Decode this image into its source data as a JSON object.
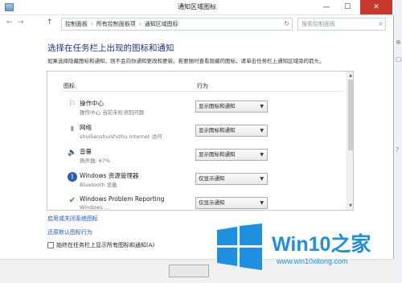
{
  "window": {
    "title": "通知区域图标"
  },
  "titlebar_buttons": {
    "min": "—",
    "max": "☐",
    "close": "✕"
  },
  "nav": {
    "back": "←",
    "forward": "→",
    "up": "↑",
    "breadcrumb": [
      "控制面板",
      "所有控制面板项",
      "通知区域图标"
    ],
    "refresh": "↻",
    "search_placeholder": "搜索控制面板"
  },
  "heading": "选择在任务栏上出现的图标和通知",
  "description": "如果选择隐藏图标和通知，则不会向你通知更改和更新。若要随时查看隐藏的图标，请单击任务栏上通知区域旁的箭头。",
  "table": {
    "col_icon": "图标",
    "col_behavior": "行为",
    "rows": [
      {
        "icon": "flag-icon",
        "glyph": "⚐",
        "name": "操作中心",
        "sub": "操作中心  当前未检测到问题",
        "behavior": "显示图标和通知"
      },
      {
        "icon": "network-icon",
        "glyph": "▮",
        "name": "网络",
        "sub": "shuilianshuishizhu Internet 访问",
        "behavior": "显示图标和通知"
      },
      {
        "icon": "speaker-icon",
        "glyph": "🔈",
        "name": "音量",
        "sub": "扬声器: 67%",
        "behavior": "显示图标和通知"
      },
      {
        "icon": "bluetooth-icon",
        "glyph": "ᛒ",
        "name": "Windows 资源管理器",
        "sub": "Bluetooth 设备",
        "behavior": "仅显示通知"
      },
      {
        "icon": "problem-reporting-icon",
        "glyph": "✔",
        "name": "Windows Problem Reporting",
        "sub": "Windows ...",
        "behavior": "仅显示通知"
      }
    ]
  },
  "links": {
    "toggle_system_icons": "启用或关闭系统图标",
    "restore_default": "还原默认图标行为"
  },
  "checkbox": {
    "label": "始终在任务栏上显示所有图标和通知(A)",
    "checked": false
  },
  "watermark": {
    "brand_en": "Win10",
    "brand_zh": "之家",
    "url": "www.win10xitong.com"
  },
  "colors": {
    "heading": "#1e3287",
    "link": "#1a58c2",
    "brand": "#1f8fe0",
    "close": "#c7392d"
  }
}
